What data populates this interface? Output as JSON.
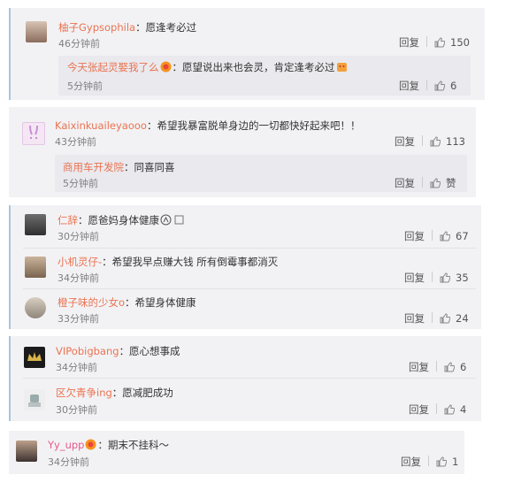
{
  "comments": [
    {
      "name": "柚子Gypsophila",
      "text": "：愿逢考必过",
      "time": "46分钟前",
      "reply": "回复",
      "likes": "150",
      "sub": {
        "name": "今天张起灵娶我了么",
        "text": "：愿望说出来也会灵，肯定逢考必过",
        "time": "5分钟前",
        "reply": "回复",
        "likes": "6"
      }
    },
    {
      "name": "Kaixinkuailеyaooo",
      "text": "：希望我暴富脱单身边的一切都快好起来吧！！",
      "time": "43分钟前",
      "reply": "回复",
      "likes": "113",
      "sub": {
        "name": "商用车开发院",
        "text": "：同喜同喜",
        "time": "5分钟前",
        "reply": "回复",
        "likes": "赞"
      }
    },
    {
      "name": "仁辞",
      "text": "：愿爸妈身体健康",
      "time": "30分钟前",
      "reply": "回复",
      "likes": "67"
    },
    {
      "name": "小机灵仔-",
      "text": "：希望我早点赚大钱 所有倒霉事都消灭",
      "time": "34分钟前",
      "reply": "回复",
      "likes": "35"
    },
    {
      "name": "橙子味的少女o",
      "text": "：希望身体健康",
      "time": "33分钟前",
      "reply": "回复",
      "likes": "24"
    },
    {
      "name": "VIPobigbang",
      "text": "：愿心想事成",
      "time": "34分钟前",
      "reply": "回复",
      "likes": "6"
    },
    {
      "name": "区欠青争ing",
      "text": "：愿减肥成功",
      "time": "30分钟前",
      "reply": "回复",
      "likes": "4"
    },
    {
      "name": "Yy_upp",
      "text": "：期末不挂科～",
      "time": "34分钟前",
      "reply": "回复",
      "likes": "1"
    }
  ],
  "colors": {
    "name": "#eb7350",
    "card": "#f2f2f5",
    "accent_bar": "#a9c4e0"
  },
  "icons": {
    "like": "thumbs-up-icon"
  }
}
